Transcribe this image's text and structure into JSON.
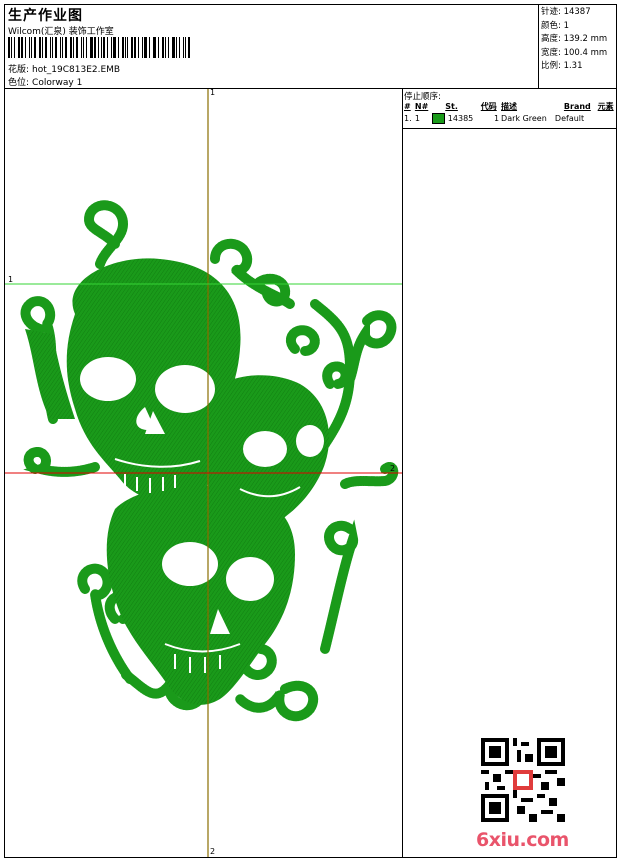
{
  "header": {
    "title": "生产作业图",
    "studio": "Wilcom(汇泉) 装饰工作室",
    "design_label": "花版:",
    "design_value": "hot_19C813E2.EMB",
    "colorway_label": "色位:",
    "colorway_value": "Colorway 1"
  },
  "stats": {
    "stitches": "针迹: 14387",
    "colors": "颜色: 1",
    "height": "高度: 139.2 mm",
    "width": "宽度: 100.4 mm",
    "scale": "比例: 1.31"
  },
  "stop_sequence": {
    "title": "停止顺序:",
    "columns": [
      "#",
      "N#",
      "St.",
      "代码",
      "描述",
      "Brand",
      "元素"
    ],
    "rows": [
      {
        "idx": "1.",
        "needle": "1",
        "stitches": "14385",
        "code": "1",
        "description": "Dark Green",
        "brand": "Default",
        "color": "#1a9a1a"
      }
    ]
  },
  "axes": {
    "v_top": "1",
    "v_bottom": "2",
    "h_green_left": "1",
    "h_red_right": "2"
  },
  "colors": {
    "thread": "#1a9a1a",
    "axis_vertical": "#8a6d00",
    "axis_green": "#35d435",
    "axis_red": "#e00000"
  },
  "watermark": "6xiu.com"
}
